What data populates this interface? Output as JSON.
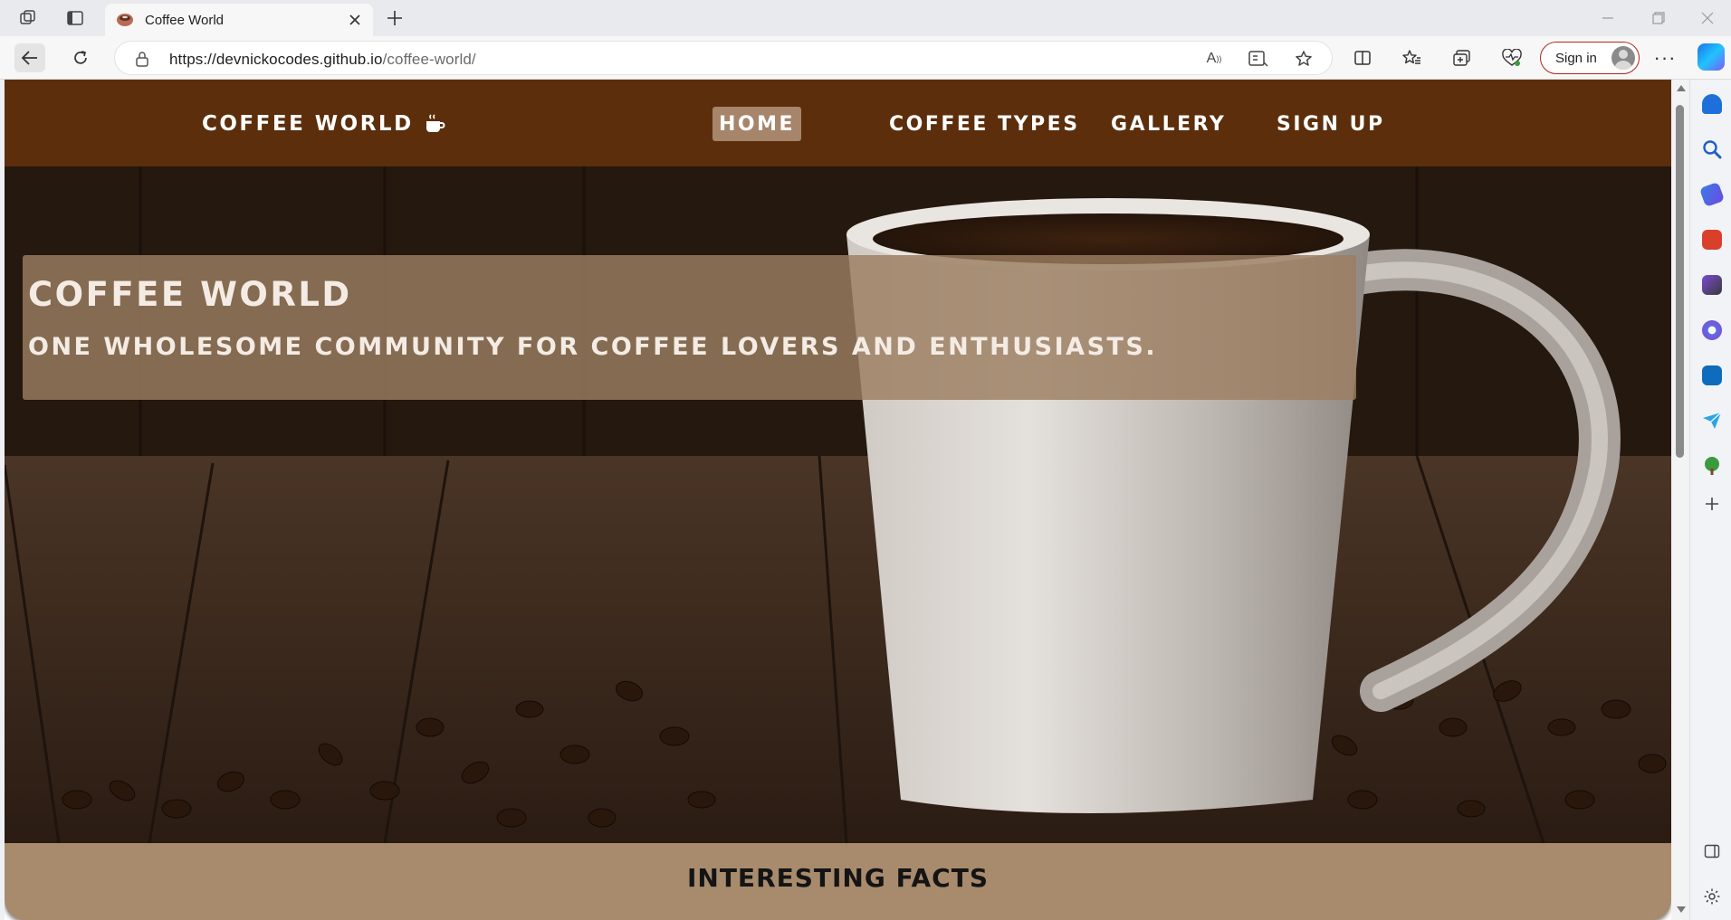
{
  "browser": {
    "tab_title": "Coffee World",
    "url_host": "https://devnickocodes.github.io",
    "url_path": "/coffee-world/",
    "signin_label": "Sign in"
  },
  "site": {
    "brand": "COFFEE WORLD",
    "nav": [
      {
        "label": "HOME",
        "active": true
      },
      {
        "label": "COFFEE TYPES",
        "active": false
      },
      {
        "label": "GALLERY",
        "active": false
      },
      {
        "label": "SIGN UP",
        "active": false
      }
    ],
    "hero": {
      "title": "COFFEE WORLD",
      "subtitle": "ONE WHOLESOME COMMUNITY FOR COFFEE LOVERS AND ENTHUSIASTS."
    },
    "facts_title": "INTERESTING FACTS"
  },
  "colors": {
    "nav_bg": "#5c2e0b",
    "nav_active_bg": "#a6856a",
    "hero_box_bg": "#9b7e60",
    "facts_bg": "#a88b6d",
    "signin_border": "#b3261e"
  },
  "icons": [
    "workspaces-icon",
    "vertical-tabs-icon",
    "coffee-favicon",
    "close-tab-icon",
    "new-tab-icon",
    "back-icon",
    "refresh-icon",
    "lock-icon",
    "read-aloud-icon",
    "immersive-reader-icon",
    "favorite-star-icon",
    "split-screen-icon",
    "favorites-icon",
    "collections-icon",
    "browser-essentials-icon",
    "profile-avatar-icon",
    "more-options-icon",
    "copilot-icon",
    "mug-icon"
  ]
}
